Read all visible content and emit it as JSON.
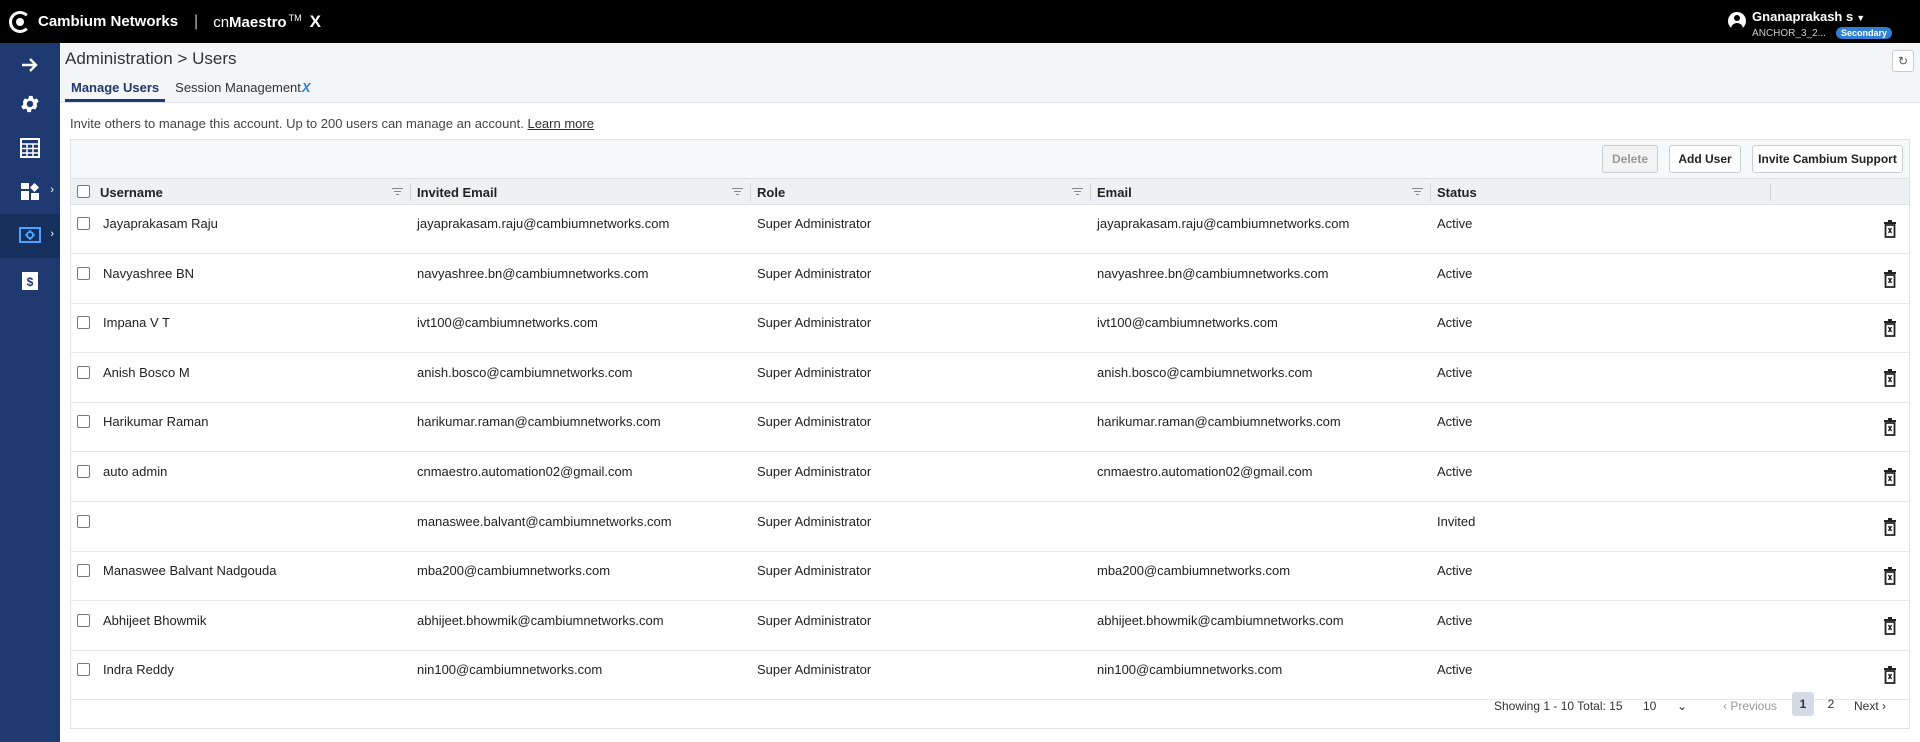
{
  "topbar": {
    "brand": "Cambium Networks",
    "product_prefix": "cn",
    "product_name": "Maestro",
    "product_tm": "TM",
    "product_suffix": "X",
    "user_name": "Gnanaprakash s",
    "account": "ANCHOR_3_2...",
    "badge": "Secondary"
  },
  "sidebar": {
    "items": [
      {
        "icon": "arrow-right-icon"
      },
      {
        "icon": "gear-icon"
      },
      {
        "icon": "table-icon"
      },
      {
        "icon": "widgets-icon"
      },
      {
        "icon": "admin-settings-icon"
      },
      {
        "icon": "billing-icon"
      }
    ]
  },
  "page": {
    "title": "Administration > Users",
    "tabs": [
      {
        "label": "Manage Users"
      },
      {
        "label": "Session Management"
      }
    ],
    "info": "Invite others to manage this account. Up to 200 users can manage an account.",
    "learn_more": "Learn more"
  },
  "toolbar": {
    "delete": "Delete",
    "add_user": "Add User",
    "invite_support": "Invite Cambium Support"
  },
  "table": {
    "columns": [
      "Username",
      "Invited Email",
      "Role",
      "Email",
      "Status"
    ],
    "rows": [
      {
        "username": "Jayaprakasam Raju",
        "invited_email": "jayaprakasam.raju@cambiumnetworks.com",
        "role": "Super Administrator",
        "email": "jayaprakasam.raju@cambiumnetworks.com",
        "status": "Active"
      },
      {
        "username": "Navyashree BN",
        "invited_email": "navyashree.bn@cambiumnetworks.com",
        "role": "Super Administrator",
        "email": "navyashree.bn@cambiumnetworks.com",
        "status": "Active"
      },
      {
        "username": "Impana V T",
        "invited_email": "ivt100@cambiumnetworks.com",
        "role": "Super Administrator",
        "email": "ivt100@cambiumnetworks.com",
        "status": "Active"
      },
      {
        "username": "Anish Bosco M",
        "invited_email": "anish.bosco@cambiumnetworks.com",
        "role": "Super Administrator",
        "email": "anish.bosco@cambiumnetworks.com",
        "status": "Active"
      },
      {
        "username": "Harikumar Raman",
        "invited_email": "harikumar.raman@cambiumnetworks.com",
        "role": "Super Administrator",
        "email": "harikumar.raman@cambiumnetworks.com",
        "status": "Active"
      },
      {
        "username": "auto admin",
        "invited_email": "cnmaestro.automation02@gmail.com",
        "role": "Super Administrator",
        "email": "cnmaestro.automation02@gmail.com",
        "status": "Active"
      },
      {
        "username": "",
        "invited_email": "manaswee.balvant@cambiumnetworks.com",
        "role": "Super Administrator",
        "email": "",
        "status": "Invited"
      },
      {
        "username": "Manaswee Balvant Nadgouda",
        "invited_email": "mba200@cambiumnetworks.com",
        "role": "Super Administrator",
        "email": "mba200@cambiumnetworks.com",
        "status": "Active"
      },
      {
        "username": "Abhijeet Bhowmik",
        "invited_email": "abhijeet.bhowmik@cambiumnetworks.com",
        "role": "Super Administrator",
        "email": "abhijeet.bhowmik@cambiumnetworks.com",
        "status": "Active"
      },
      {
        "username": "Indra Reddy",
        "invited_email": "nin100@cambiumnetworks.com",
        "role": "Super Administrator",
        "email": "nin100@cambiumnetworks.com",
        "status": "Active"
      }
    ]
  },
  "pager": {
    "showing": "Showing 1 - 10 Total: 15",
    "page_size": "10",
    "previous": "Previous",
    "pages": [
      "1",
      "2"
    ],
    "next": "Next"
  }
}
